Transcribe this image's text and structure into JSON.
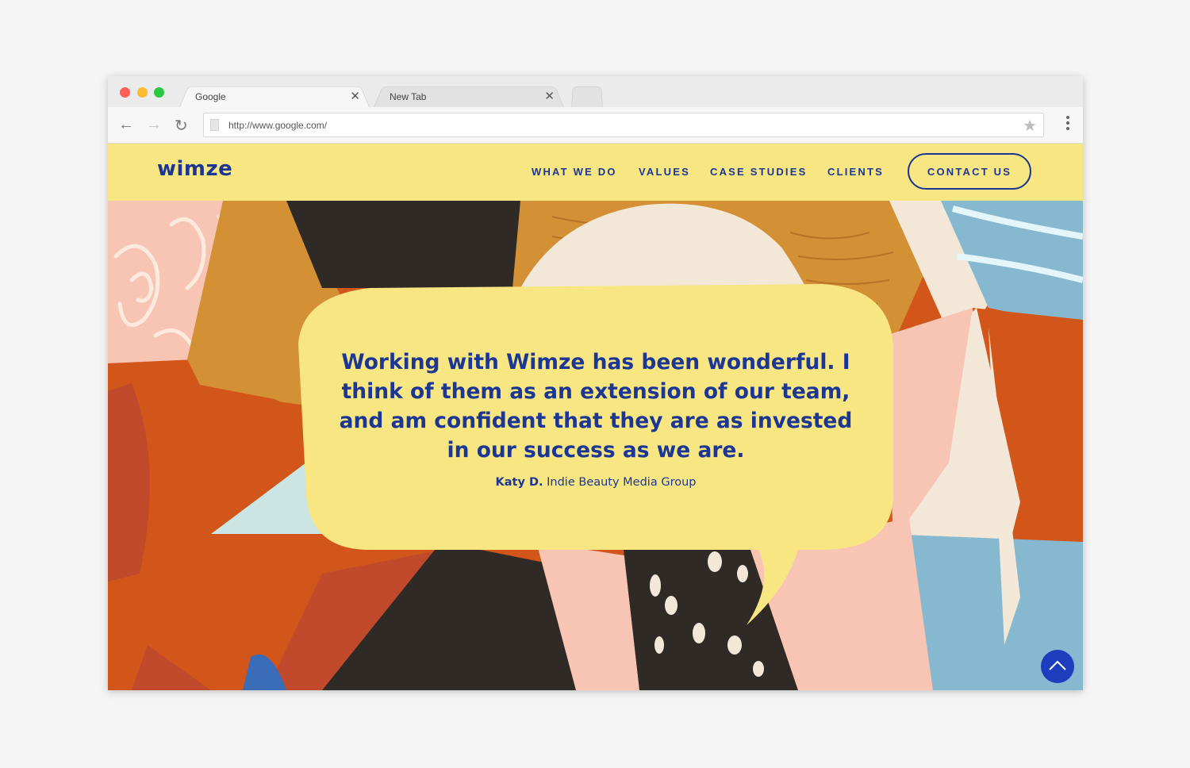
{
  "browser": {
    "tabs": [
      {
        "label": "Google",
        "close": "✕"
      },
      {
        "label": "New Tab",
        "close": "✕"
      }
    ],
    "back_icon": "←",
    "forward_icon": "→",
    "reload_icon": "↻",
    "url": "http://www.google.com/",
    "star_icon": "★"
  },
  "site": {
    "logo": "wimze",
    "nav": [
      {
        "label": "WHAT WE DO"
      },
      {
        "label": "VALUES"
      },
      {
        "label": "CASE STUDIES"
      },
      {
        "label": "CLIENTS"
      }
    ],
    "contact_label": "CONTACT US",
    "accent_color": "#1c3694",
    "header_color": "#f8e683"
  },
  "testimonial": {
    "quote": "Working with Wimze has been wonderful. I think of them as an extension of our team, and am confident that they are as invested in our success as we are.",
    "author": "Katy D.",
    "company": "Indie Beauty Media Group"
  }
}
